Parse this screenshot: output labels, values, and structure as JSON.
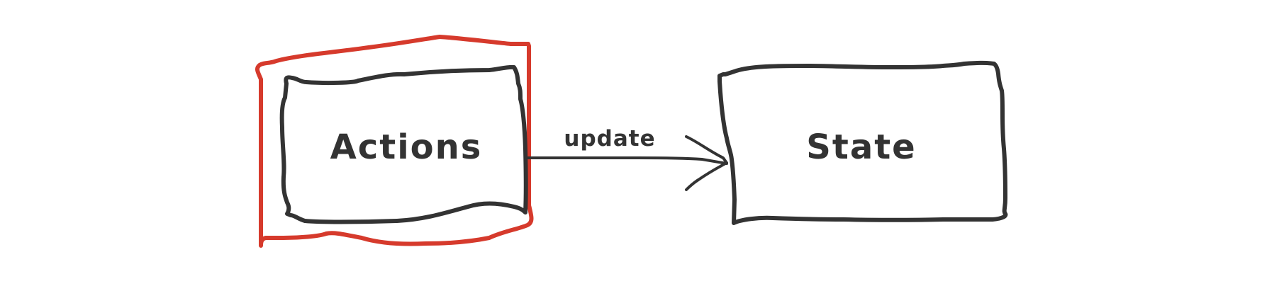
{
  "diagram": {
    "nodes": [
      {
        "id": "actions",
        "label": "Actions",
        "highlighted": true
      },
      {
        "id": "state",
        "label": "State",
        "highlighted": false
      }
    ],
    "edges": [
      {
        "from": "actions",
        "to": "state",
        "label": "update"
      }
    ]
  },
  "colors": {
    "stroke": "#333333",
    "highlight": "#d63a2c",
    "background": "#ffffff"
  }
}
